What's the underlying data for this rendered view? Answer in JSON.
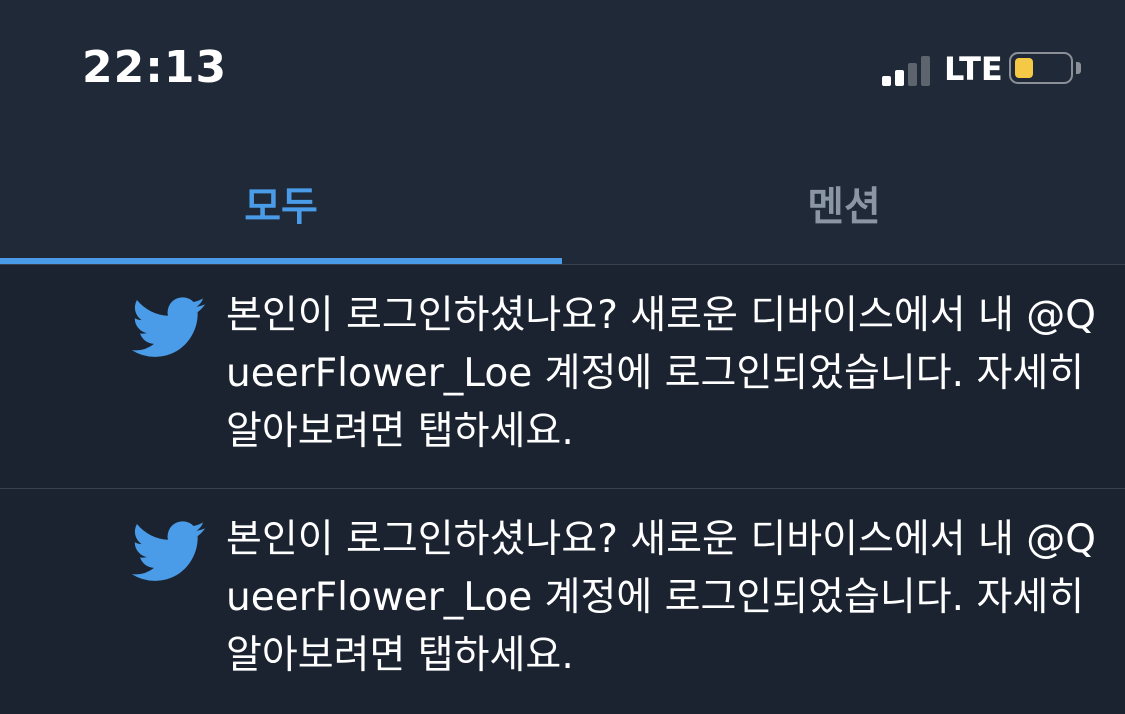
{
  "status_bar": {
    "time": "22:13",
    "network": "LTE",
    "signal_bars_active": 2,
    "signal_bars_total": 4,
    "battery_level": 0.35,
    "battery_color": "#f5c945"
  },
  "tabs": [
    {
      "label": "모두",
      "selected": true
    },
    {
      "label": "멘션",
      "selected": false
    }
  ],
  "colors": {
    "accent": "#4a9ce8",
    "inactive_tab": "#8b96a4",
    "background": "#1b2330",
    "header_background": "#202937",
    "divider": "#38414e"
  },
  "notifications": [
    {
      "icon": "twitter-bird-icon",
      "text": "본인이 로그인하셨나요? 새로운 디바이스에서 내 @QueerFlower_Loe 계정에 로그인되었습니다. 자세히 알아보려면 탭하세요."
    },
    {
      "icon": "twitter-bird-icon",
      "text": "본인이 로그인하셨나요? 새로운 디바이스에서 내 @QueerFlower_Loe 계정에 로그인되었습니다. 자세히 알아보려면 탭하세요."
    }
  ]
}
